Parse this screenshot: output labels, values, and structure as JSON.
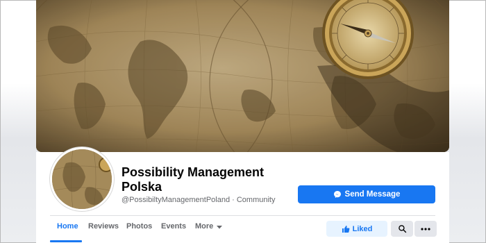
{
  "profile": {
    "name": "Possibility Management Polska",
    "handle_line": "@PossibiltyManagementPoland · Community"
  },
  "actions": {
    "send_message": "Send Message",
    "liked": "Liked"
  },
  "tabs": [
    {
      "label": "Home",
      "active": true
    },
    {
      "label": "Reviews",
      "active": false
    },
    {
      "label": "Photos",
      "active": false
    },
    {
      "label": "Events",
      "active": false
    },
    {
      "label": "More",
      "active": false
    }
  ],
  "colors": {
    "accent": "#1877f2",
    "liked_bg": "#e7f3ff",
    "neutral_button": "#e4e6eb"
  },
  "icons": {
    "messenger": "messenger-icon",
    "like": "thumbs-up-icon",
    "search": "search-icon",
    "more": "ellipsis-icon",
    "dropdown": "caret-down-icon"
  }
}
